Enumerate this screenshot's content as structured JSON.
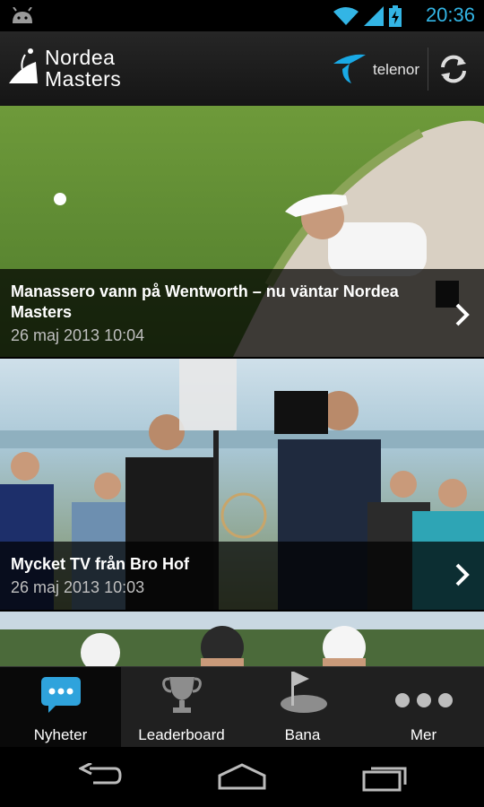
{
  "status_bar": {
    "time": "20:36",
    "icons": [
      "android-icon",
      "wifi-icon",
      "signal-icon",
      "battery-charging-icon"
    ],
    "accent_color": "#33b5e5"
  },
  "action_bar": {
    "app_title": "Nordea\nMasters",
    "sponsor": "telenor",
    "actions": [
      "refresh-icon"
    ]
  },
  "news": [
    {
      "title": "Manassero vann på Wentworth – nu väntar Nordea Masters",
      "date": "26 maj 2013 10:04"
    },
    {
      "title": "Mycket TV från Bro Hof",
      "date": "26 maj 2013 10:03"
    }
  ],
  "tabs": [
    {
      "label": "Nyheter",
      "icon": "chat-bubble-icon",
      "active": true
    },
    {
      "label": "Leaderboard",
      "icon": "trophy-icon",
      "active": false
    },
    {
      "label": "Bana",
      "icon": "golf-flag-icon",
      "active": false
    },
    {
      "label": "Mer",
      "icon": "more-dots-icon",
      "active": false
    }
  ],
  "nav_bar": [
    "back-icon",
    "home-icon",
    "recent-apps-icon"
  ]
}
